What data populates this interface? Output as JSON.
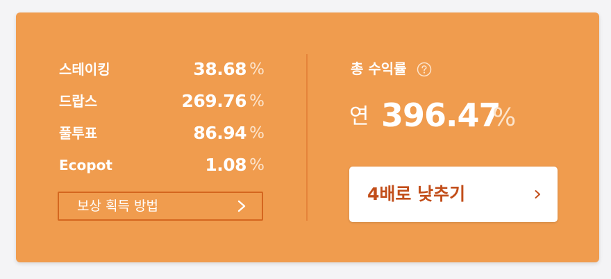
{
  "rewards": [
    {
      "name": "스테이킹",
      "value": "38.68",
      "unit": "%"
    },
    {
      "name": "드랍스",
      "value": "269.76",
      "unit": "%"
    },
    {
      "name": "풀투표",
      "value": "86.94",
      "unit": "%"
    },
    {
      "name": "Ecopot",
      "value": "1.08",
      "unit": "%"
    }
  ],
  "method_button": {
    "label": "보상 획득 방법",
    "icon": "chevron-right-icon"
  },
  "total": {
    "title": "총 수익률",
    "help_icon": "question-circle-icon",
    "prefix": "연",
    "value": "396.47",
    "unit": "%"
  },
  "lower_button": {
    "label": "4배로 낮추기",
    "icon": "chevron-right-icon"
  },
  "colors": {
    "card_background": "#f09c4e",
    "accent_text": "#c24e1a",
    "button_border": "#d4661f",
    "unit_text": "#fce4cc"
  }
}
